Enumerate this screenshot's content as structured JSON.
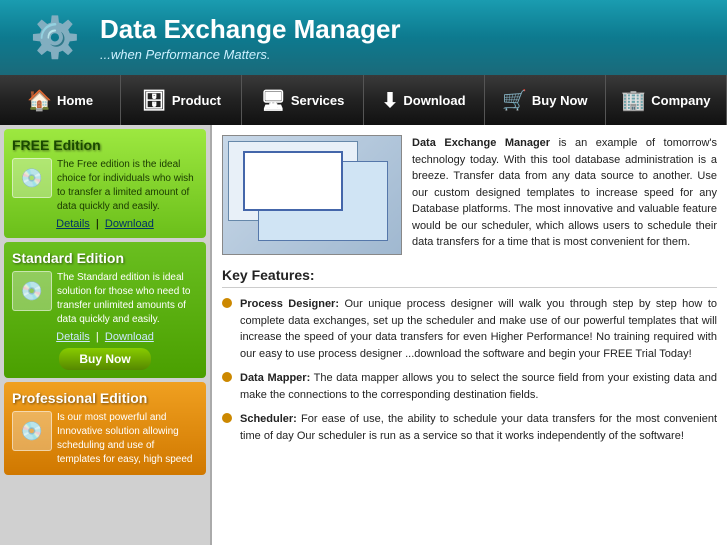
{
  "header": {
    "title": "Data Exchange Manager",
    "subtitle": "...when Performance Matters.",
    "logo_icon": "⚙"
  },
  "nav": {
    "items": [
      {
        "id": "home",
        "label": "Home",
        "icon": "🏠"
      },
      {
        "id": "product",
        "label": "Product",
        "icon": "🗄"
      },
      {
        "id": "services",
        "label": "Services",
        "icon": "🖥"
      },
      {
        "id": "download",
        "label": "Download",
        "icon": "⬇"
      },
      {
        "id": "buynow",
        "label": "Buy Now",
        "icon": "🛒"
      },
      {
        "id": "company",
        "label": "Company",
        "icon": "🏢"
      }
    ]
  },
  "sidebar": {
    "free_edition": {
      "title": "FREE Edition",
      "description": "The Free edition is the ideal choice for individuals who wish to transfer a limited amount of data quickly and easily.",
      "links": [
        "Details",
        "Download"
      ]
    },
    "standard_edition": {
      "title": "Standard Edition",
      "description": "The Standard edition is ideal solution for those who need to transfer unlimited amounts of data quickly and easily.",
      "links": [
        "Details",
        "Download"
      ],
      "buy_label": "Buy Now"
    },
    "professional_edition": {
      "title": "Professional Edition",
      "description": "Is our most powerful and Innovative solution allowing scheduling and use of templates for easy, high speed"
    }
  },
  "content": {
    "product_description": "Data Exchange Manager is an example of tomorrow's technology today. With this tool database administration is a breeze. Transfer data from any data source to another. Use our custom designed templates to increase speed for any Database platforms. The most innovative and valuable feature would be our scheduler, which allows users to schedule their data transfers for a time that is most convenient for them.",
    "key_features_title": "Key Features:",
    "features": [
      {
        "label": "Process Designer:",
        "text": " Our unique process designer will walk you through step by step how to complete data exchanges, set up the scheduler and make use of our powerful templates that will increase the speed of your data transfers for even Higher Performance! No training required with our easy to use process designer ...download the software and begin your FREE Trial Today!"
      },
      {
        "label": "Data Mapper:",
        "text": " The data mapper allows you to select the source field from your existing data and make the connections to the corresponding destination fields."
      },
      {
        "label": "Scheduler:",
        "text": " For ease of use, the ability to schedule your data transfers for the most convenient time of day Our scheduler is run as a service so that it works independently of the software!"
      }
    ]
  }
}
